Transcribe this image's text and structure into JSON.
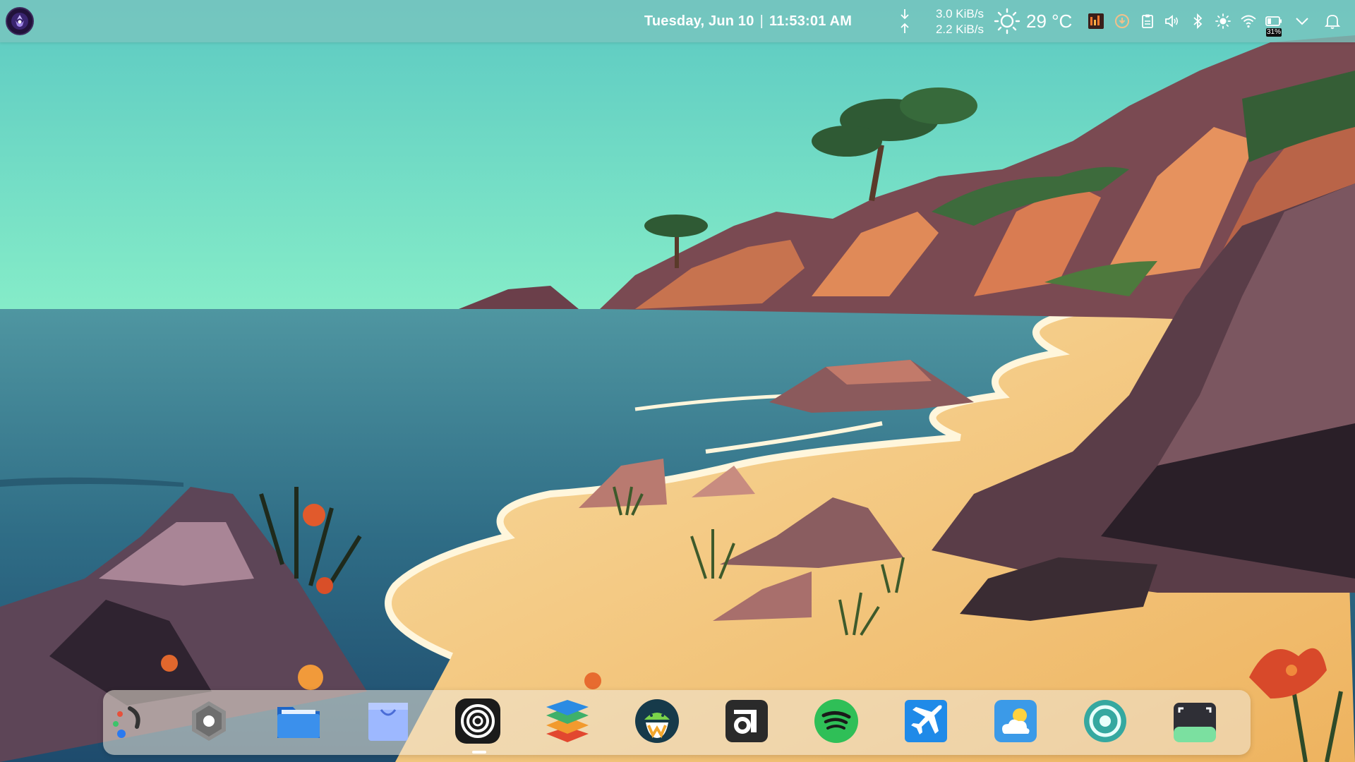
{
  "top_panel": {
    "clock": {
      "date": "Tuesday, Jun 10",
      "separator": "|",
      "time": "11:53:01 AM"
    },
    "network": {
      "download": "3.0 KiB/s",
      "upload": "2.2 KiB/s"
    },
    "weather": {
      "temperature": "29 °C",
      "icon": "sun-icon"
    },
    "tray_icons": [
      "system-monitor-icon",
      "update-icon",
      "clipboard-icon",
      "volume-icon",
      "bluetooth-icon",
      "brightness-icon",
      "wifi-icon",
      "battery-icon",
      "chevron-down-icon",
      "bell-icon"
    ],
    "battery_percent": "31%"
  },
  "dock": {
    "items": [
      "app-launcher-icon",
      "settings-icon",
      "files-icon",
      "store-icon",
      "onion-app-icon",
      "layers-app-icon",
      "android-app-icon",
      "media-app-icon",
      "spotify-icon",
      "flight-app-icon",
      "weather-app-icon",
      "system-app-icon",
      "screenshot-app-icon"
    ]
  },
  "colors": {
    "sky": "#7fe0c6",
    "sea": "#2f6d86",
    "sand": "#f2c679",
    "cliff": "#5a3b47",
    "panel": "#7ac4be"
  }
}
